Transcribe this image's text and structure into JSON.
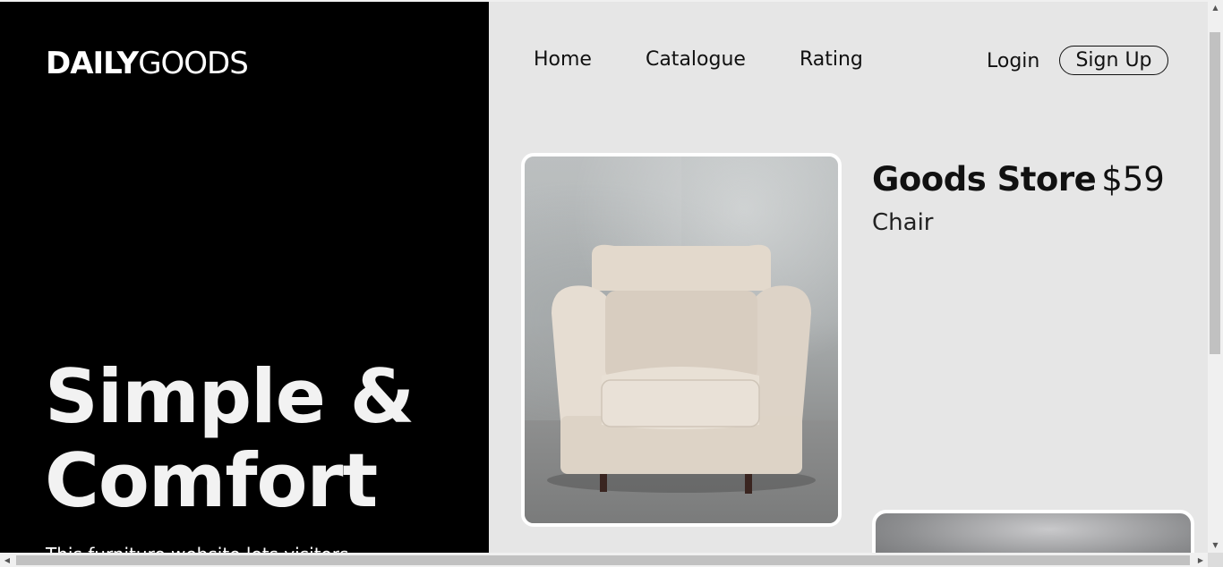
{
  "brand": {
    "bold": "DAILY",
    "light": "GOODS"
  },
  "hero": {
    "title_line1": "Simple &",
    "title_line2": "Comfort",
    "description": "This furniture website lets visitors"
  },
  "nav": {
    "links": [
      "Home",
      "Catalogue",
      "Rating"
    ],
    "login": "Login",
    "signup": "Sign Up"
  },
  "product": {
    "store": "Goods Store",
    "price": "$59",
    "name": "Chair",
    "image_icon": "armchair-image"
  },
  "scrollbars": {
    "up_arrow": "▲",
    "down_arrow": "▼",
    "left_arrow": "◀",
    "right_arrow": "▶"
  },
  "colors": {
    "left_bg": "#000000",
    "right_bg": "#e6e6e6",
    "text": "#111111"
  }
}
